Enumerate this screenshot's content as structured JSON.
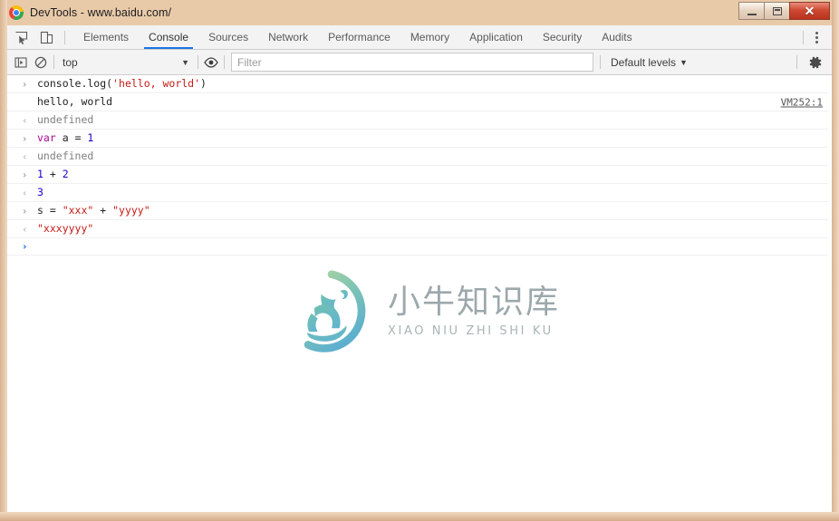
{
  "window": {
    "title": "DevTools - www.baidu.com/",
    "logo_icon": "chrome-logo-icon",
    "controls": {
      "minimize_label": "–",
      "maximize_label": "□",
      "close_label": "✕"
    },
    "frame_color": "#e8c9a8"
  },
  "tabstrip": {
    "left_icons": [
      {
        "name": "inspect-element-icon",
        "title": "Inspect element"
      },
      {
        "name": "device-toolbar-icon",
        "title": "Toggle device toolbar"
      }
    ],
    "tabs": [
      {
        "label": "Elements",
        "active": false
      },
      {
        "label": "Console",
        "active": true
      },
      {
        "label": "Sources",
        "active": false
      },
      {
        "label": "Network",
        "active": false
      },
      {
        "label": "Performance",
        "active": false
      },
      {
        "label": "Memory",
        "active": false
      },
      {
        "label": "Application",
        "active": false
      },
      {
        "label": "Security",
        "active": false
      },
      {
        "label": "Audits",
        "active": false
      }
    ],
    "active_tab": "Console",
    "active_underline_color": "#1a73e8",
    "more_menu_icon": "vertical-dots-icon"
  },
  "filterbar": {
    "sidebar_toggle_icon": "console-sidebar-icon",
    "clear_console_icon": "clear-console-icon",
    "context": {
      "value": "top",
      "caret": "▼"
    },
    "eye_icon": "live-expression-eye-icon",
    "filter": {
      "value": "",
      "placeholder": "Filter"
    },
    "levels": {
      "label": "Default levels",
      "caret": "▼"
    },
    "settings_icon": "gear-icon"
  },
  "console": {
    "entries": [
      {
        "kind": "input",
        "arrow": "›",
        "tokens": [
          {
            "text": "console.log(",
            "type": "plain"
          },
          {
            "text": "'hello, world'",
            "type": "string"
          },
          {
            "text": ")",
            "type": "plain"
          }
        ],
        "source_link": ""
      },
      {
        "kind": "log",
        "arrow": "",
        "tokens": [
          {
            "text": "hello, world",
            "type": "plain"
          }
        ],
        "source_link": "VM252:1"
      },
      {
        "kind": "output",
        "arrow": "‹",
        "tokens": [
          {
            "text": "undefined",
            "type": "grey"
          }
        ],
        "source_link": ""
      },
      {
        "kind": "input",
        "arrow": "›",
        "tokens": [
          {
            "text": "var",
            "type": "keyword"
          },
          {
            "text": " a ",
            "type": "plain"
          },
          {
            "text": "= ",
            "type": "plain"
          },
          {
            "text": "1",
            "type": "number"
          }
        ],
        "source_link": ""
      },
      {
        "kind": "output",
        "arrow": "‹",
        "tokens": [
          {
            "text": "undefined",
            "type": "grey"
          }
        ],
        "source_link": ""
      },
      {
        "kind": "input",
        "arrow": "›",
        "tokens": [
          {
            "text": "1",
            "type": "number"
          },
          {
            "text": " + ",
            "type": "plain"
          },
          {
            "text": "2",
            "type": "number"
          }
        ],
        "source_link": ""
      },
      {
        "kind": "output",
        "arrow": "‹",
        "tokens": [
          {
            "text": "3",
            "type": "number"
          }
        ],
        "source_link": ""
      },
      {
        "kind": "input",
        "arrow": "›",
        "tokens": [
          {
            "text": "s = ",
            "type": "plain"
          },
          {
            "text": "\"xxx\"",
            "type": "string"
          },
          {
            "text": " + ",
            "type": "plain"
          },
          {
            "text": "\"yyyy\"",
            "type": "string"
          }
        ],
        "source_link": ""
      },
      {
        "kind": "output",
        "arrow": "‹",
        "tokens": [
          {
            "text": "\"xxxyyyy\"",
            "type": "string"
          }
        ],
        "source_link": ""
      }
    ],
    "prompt": {
      "arrow": "›",
      "value": ""
    },
    "colors": {
      "string": "#c41a16",
      "number": "#1c00cf",
      "keyword": "#aa0d91",
      "grey": "#808080",
      "prompt": "#1a73e8"
    }
  },
  "watermark": {
    "cn_text": "小牛知识库",
    "en_text": "XIAO NIU ZHI SHI KU",
    "logo_icon": "ox-circle-logo-icon",
    "gradient_from": "#8fc9a0",
    "gradient_to": "#5aaed0"
  },
  "sogou_badge": {
    "icon": "sogou-s-logo-icon",
    "color": "#f05a28"
  }
}
